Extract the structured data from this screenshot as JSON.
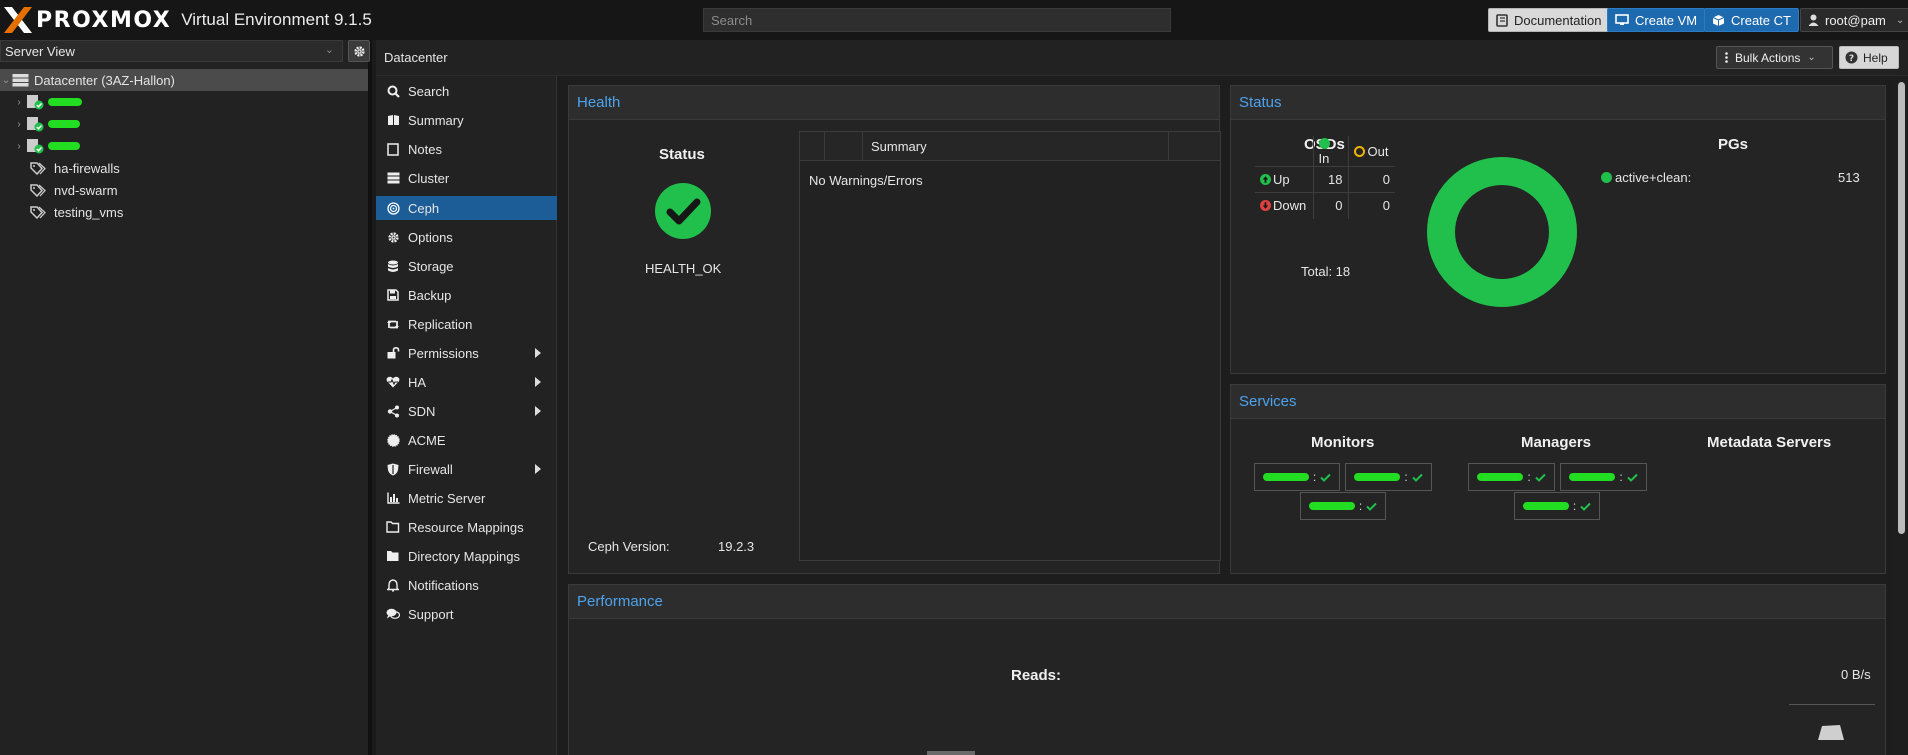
{
  "app": {
    "logo_text": "PROXMOX",
    "version_label": "Virtual Environment 9.1.5"
  },
  "topbar": {
    "search_placeholder": "Search",
    "documentation_label": "Documentation",
    "create_vm_label": "Create VM",
    "create_ct_label": "Create CT",
    "user_label": "root@pam"
  },
  "tree": {
    "view_label": "Server View",
    "datacenter_label": "Datacenter (3AZ-Hallon)",
    "pools": [
      "ha-firewalls",
      "nvd-swarm",
      "testing_vms"
    ]
  },
  "breadcrumb": {
    "label": "Datacenter",
    "bulk_actions_label": "Bulk Actions",
    "help_label": "Help"
  },
  "nav": {
    "items": [
      {
        "label": "Search",
        "icon": "search-icon"
      },
      {
        "label": "Summary",
        "icon": "book-icon"
      },
      {
        "label": "Notes",
        "icon": "notes-icon"
      },
      {
        "label": "Cluster",
        "icon": "server-icon"
      },
      {
        "label": "Ceph",
        "icon": "ceph-icon"
      },
      {
        "label": "Options",
        "icon": "gear-icon"
      },
      {
        "label": "Storage",
        "icon": "database-icon"
      },
      {
        "label": "Backup",
        "icon": "floppy-icon"
      },
      {
        "label": "Replication",
        "icon": "retweet-icon"
      },
      {
        "label": "Permissions",
        "icon": "unlock-icon"
      },
      {
        "label": "HA",
        "icon": "heartbeat-icon"
      },
      {
        "label": "SDN",
        "icon": "network-icon"
      },
      {
        "label": "ACME",
        "icon": "certificate-icon"
      },
      {
        "label": "Firewall",
        "icon": "shield-icon"
      },
      {
        "label": "Metric Server",
        "icon": "bar-chart-icon"
      },
      {
        "label": "Resource Mappings",
        "icon": "folder-icon"
      },
      {
        "label": "Directory Mappings",
        "icon": "folder-icon"
      },
      {
        "label": "Notifications",
        "icon": "bell-icon"
      },
      {
        "label": "Support",
        "icon": "comments-icon"
      }
    ],
    "active": "Ceph"
  },
  "health": {
    "title": "Health",
    "status_heading": "Status",
    "status_value": "HEALTH_OK",
    "version_label": "Ceph Version:",
    "version_value": "19.2.3",
    "summary_header": "Summary",
    "summary_text": "No Warnings/Errors"
  },
  "status": {
    "title": "Status",
    "osds_heading": "OSDs",
    "col_in": "In",
    "col_out": "Out",
    "row_up": "Up",
    "row_down": "Down",
    "up_in": "18",
    "up_out": "0",
    "down_in": "0",
    "down_out": "0",
    "total_label": "Total: 18",
    "pgs_heading": "PGs",
    "pg_state": "active+clean:",
    "pg_count": "513",
    "pg_active_clean_fraction": 1.0
  },
  "services": {
    "title": "Services",
    "monitors_heading": "Monitors",
    "managers_heading": "Managers",
    "mds_heading": "Metadata Servers"
  },
  "performance": {
    "title": "Performance",
    "reads_label": "Reads:",
    "reads_value": "0 B/s"
  },
  "colors": {
    "accent_blue": "#1c5d97",
    "panel_title_blue": "#4da3ee",
    "ok_green": "#21bf4b",
    "warn_yellow": "#f0b400",
    "error_red": "#e04040"
  }
}
